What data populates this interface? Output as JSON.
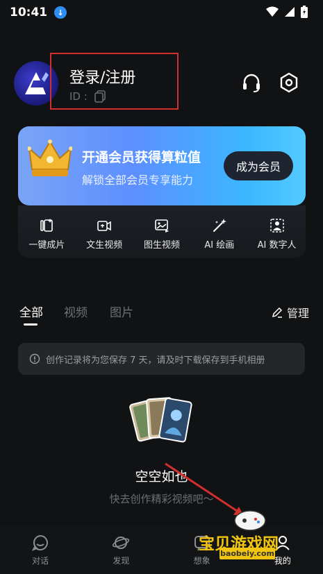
{
  "status_bar": {
    "time": "10:41"
  },
  "profile": {
    "title": "登录/注册",
    "id_label": "ID :"
  },
  "vip": {
    "title": "开通会员获得算粒值",
    "subtitle": "解锁全部会员专享能力",
    "button": "成为会员"
  },
  "tools": [
    {
      "label": "一键成片",
      "icon": "clip-icon"
    },
    {
      "label": "文生视频",
      "icon": "text-video-icon"
    },
    {
      "label": "图生视频",
      "icon": "image-video-icon"
    },
    {
      "label": "AI 绘画",
      "icon": "magic-brush-icon"
    },
    {
      "label": "AI 数字人",
      "icon": "digital-human-icon"
    }
  ],
  "tabs": {
    "all": "全部",
    "video": "视频",
    "image": "图片",
    "manage": "管理"
  },
  "notice": "创作记录将为您保存 7 天，请及时下载保存到手机相册",
  "empty": {
    "title": "空空如也",
    "subtitle": "快去创作精彩视频吧～"
  },
  "bottom_nav": [
    {
      "label": "对话",
      "icon": "chat-icon"
    },
    {
      "label": "发现",
      "icon": "planet-icon"
    },
    {
      "label": "想象",
      "icon": "imagine-icon"
    },
    {
      "label": "我的",
      "icon": "profile-icon"
    }
  ],
  "watermark": {
    "text": "宝贝游戏网",
    "url": "baobeiy.com"
  },
  "colors": {
    "accent": "#3bb7ff",
    "highlight_box": "#d32f2f",
    "watermark": "#f1c40f"
  }
}
